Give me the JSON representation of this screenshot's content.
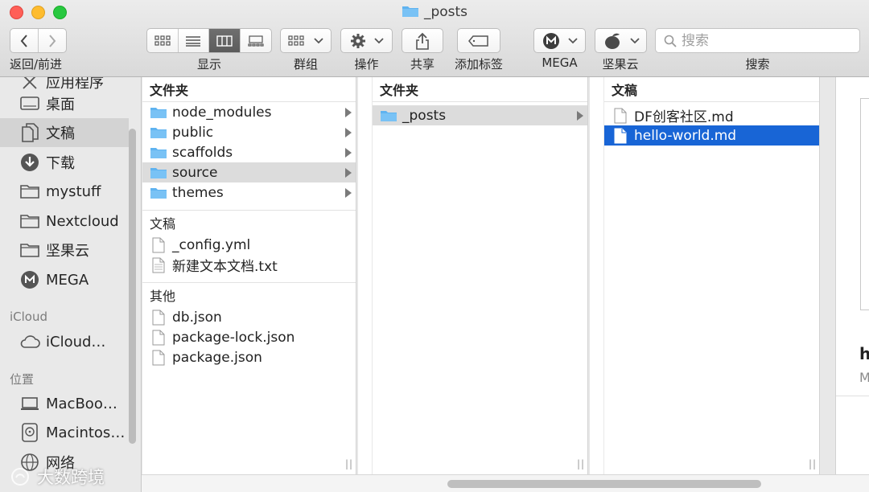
{
  "window": {
    "title": "_posts"
  },
  "toolbar": {
    "nav_label": "返回/前进",
    "view_label": "显示",
    "group_label": "群组",
    "action_label": "操作",
    "share_label": "共享",
    "tags_label": "添加标签",
    "mega_label": "MEGA",
    "jianguoyun_label": "坚果云",
    "search_label": "搜索",
    "search_placeholder": "搜索",
    "active_view": "columns"
  },
  "sidebar": {
    "partial_item": "应用程序",
    "items": [
      {
        "label": "桌面",
        "icon": "desktop-icon"
      },
      {
        "label": "文稿",
        "icon": "documents-icon",
        "selected": true
      },
      {
        "label": "下载",
        "icon": "downloads-icon"
      },
      {
        "label": "mystuff",
        "icon": "folder-icon"
      },
      {
        "label": "Nextcloud",
        "icon": "folder-icon"
      },
      {
        "label": "坚果云",
        "icon": "folder-icon"
      },
      {
        "label": "MEGA",
        "icon": "mega-icon"
      }
    ],
    "icloud_header": "iCloud",
    "icloud_item": "iCloud…",
    "locations_header": "位置",
    "locations": [
      {
        "label": "MacBoo…",
        "icon": "laptop-icon"
      },
      {
        "label": "Macintos…",
        "icon": "disk-icon"
      },
      {
        "label": "网络",
        "icon": "network-icon"
      }
    ]
  },
  "columns": {
    "col1": {
      "folders_header": "文件夹",
      "folders": [
        "node_modules",
        "public",
        "scaffolds",
        "source",
        "themes"
      ],
      "selected_folder": "source",
      "docs_header": "文稿",
      "docs": [
        "_config.yml",
        "新建文本文档.txt"
      ],
      "other_header": "其他",
      "other": [
        "db.json",
        "package-lock.json",
        "package.json"
      ]
    },
    "col2": {
      "folders_header": "文件夹",
      "folders": [
        "_posts"
      ]
    },
    "col3": {
      "docs_header": "文稿",
      "docs": [
        "DF创客社区.md",
        "hello-world.md"
      ],
      "selected_doc": "hello-world.md"
    }
  },
  "preview": {
    "title_fragment": "h",
    "meta_fragment": "M"
  },
  "watermark": "大数跨境",
  "colors": {
    "selection_blue": "#1865d6",
    "folder_blue": "#5fb3f0"
  }
}
